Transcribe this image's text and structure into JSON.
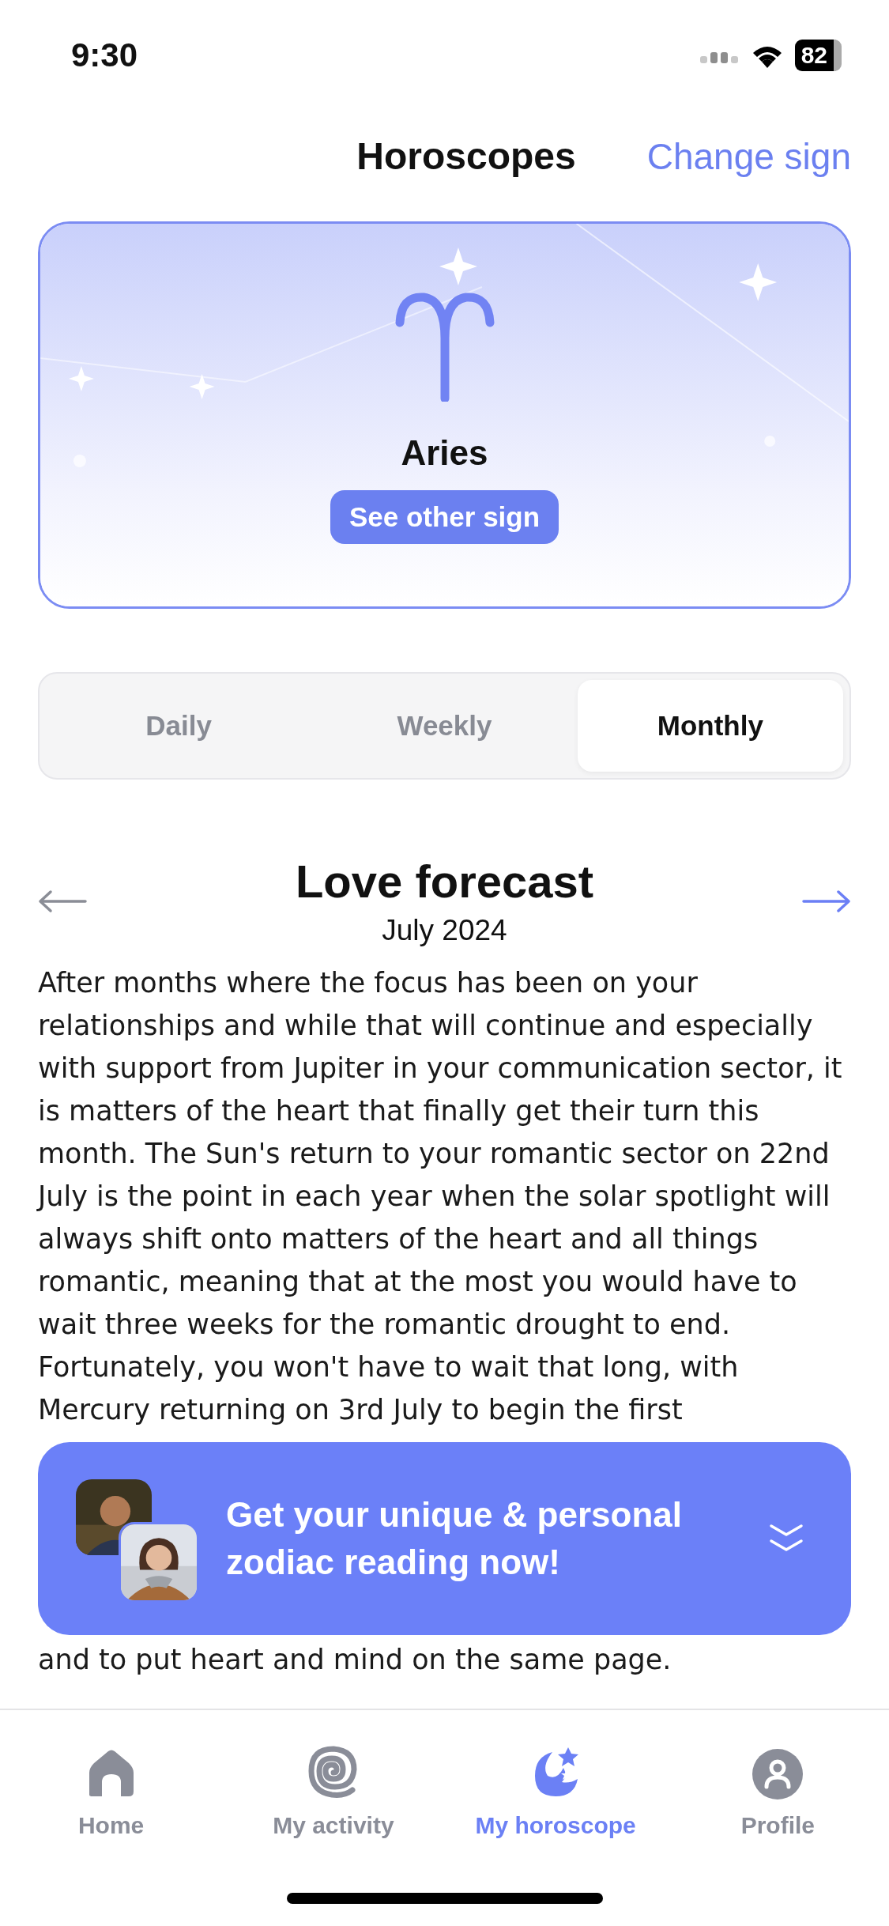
{
  "status_bar": {
    "time": "9:30",
    "battery": "82"
  },
  "header": {
    "title": "Horoscopes",
    "action": "Change sign"
  },
  "sign_card": {
    "name": "Aries",
    "button": "See other sign"
  },
  "tabs": [
    {
      "label": "Daily",
      "selected": false
    },
    {
      "label": "Weekly",
      "selected": false
    },
    {
      "label": "Monthly",
      "selected": true
    }
  ],
  "forecast": {
    "title": "Love forecast",
    "period": "July 2024",
    "prev_disabled": true,
    "next_disabled": false,
    "paragraphs": [
      "After months where the focus has been on your relationships and while that will continue and especially with support from Jupiter in your communication sector, it is matters of the heart that finally get their turn this month. The Sun's return to your romantic sector on 22nd July is the point in each year when the solar spotlight will always shift onto matters of the heart and all things romantic, meaning that at the most you would have to wait three weeks for the romantic drought to end. Fortunately, you won't have to wait that long, with Mercury returning on 3rd July to begin the first",
      "and to put heart and mind on the same page."
    ]
  },
  "banner": {
    "text": "Get your unique & personal zodiac reading now!"
  },
  "nav": [
    {
      "label": "Home",
      "kind": "home",
      "selected": false
    },
    {
      "label": "My activity",
      "kind": "activity",
      "selected": false
    },
    {
      "label": "My horoscope",
      "kind": "horoscope",
      "selected": true
    },
    {
      "label": "Profile",
      "kind": "profile",
      "selected": false
    }
  ]
}
